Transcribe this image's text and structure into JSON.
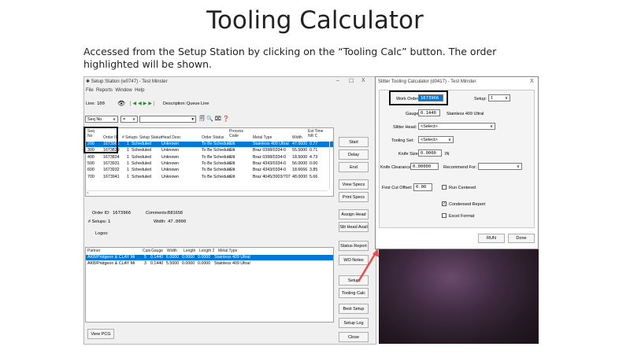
{
  "slide": {
    "title": "Tooling Calculator",
    "description": "Accessed from the Setup Station by clicking on the “Tooling Calc” button. The order highlighted will be shown."
  },
  "setup_window": {
    "title": "Setup Station (w0747) - Test Minster",
    "menu": [
      "File",
      "Reports",
      "Window",
      "Help"
    ],
    "line_label": "Line:",
    "line_value": "100",
    "description_label": "Description:",
    "description_value": "Queue Line",
    "seq_dropdown": "Seq No",
    "op_dropdown": "=",
    "columns": [
      "Seq No",
      "Order ID",
      "# Setups",
      "Setup Status",
      "Head Desc",
      "Order Status",
      "Process Code",
      "Metal Type",
      "Width",
      "Est Time NR C"
    ],
    "rows": [
      [
        "200",
        "1673966",
        "1",
        "Scheduled",
        "Unknown",
        "To Be Schedule",
        "Slit",
        "Stainless 409 Ultral",
        "47.0000",
        "0.77"
      ],
      [
        "300",
        "1673829",
        "1",
        "Scheduled",
        "Unknown",
        "To Be Schedule",
        "Slit",
        "Braz 0398/0334-0",
        "55.5000",
        "0.71"
      ],
      [
        "400",
        "1673824",
        "1",
        "Scheduled",
        "Unknown",
        "To Be Schedule",
        "Slit",
        "Braz 0398/0334-0",
        "18.5000",
        "4.73"
      ],
      [
        "500",
        "1673931",
        "1",
        "Scheduled",
        "Unknown",
        "To Be Schedule",
        "Slit",
        "Braz 4343/0334-0",
        "56.0000",
        "0.00"
      ],
      [
        "600",
        "1673932",
        "1",
        "Scheduled",
        "Unknown",
        "To Be Schedule",
        "Slit",
        "Braz 4343/0334-0",
        "18.6666",
        "3.85"
      ],
      [
        "700",
        "1673941",
        "1",
        "Scheduled",
        "Unknown",
        "To Be Schedule",
        "Slit",
        "Braz 4045/3003/707",
        "48.0000",
        "5.66"
      ]
    ],
    "details": {
      "order_id_label": "Order ID:",
      "order_id": "1673966",
      "comments_label": "Comments:",
      "comments": "B81658",
      "setups_label": "# Setups:",
      "setups": "1",
      "width_label": "Width:",
      "width": "47.0000",
      "logos_label": "Logos:"
    },
    "partner_columns": [
      "Partner",
      "Cuts",
      "Gauge",
      "Width",
      "Length",
      "Length 2",
      "Metal Type"
    ],
    "partner_rows": [
      [
        "AKB/Pridgeon & CLAY Mi",
        "5",
        "0.1440",
        "6.0000",
        "0.0000",
        "0.0000",
        "Stainless 409 Ultral"
      ],
      [
        "AKB/Pridgeon & CLAY Mi",
        "3",
        "0.1440",
        "5.5000",
        "0.0000",
        "0.0000",
        "Stainless 409 Ultral"
      ]
    ],
    "buttons": {
      "start": "Start",
      "delay": "Delay",
      "end": "End",
      "view_specs": "View Specs",
      "print_specs": "Print Specs",
      "assign_head": "Assign Head",
      "slit_head_avail": "Slit Head Avail",
      "status_report": "Status Report",
      "wo_notes": "WO Notes",
      "setup": "Setup",
      "tooling_calc": "Tooling Calc",
      "best_setup": "Best Setup",
      "setup_log": "Setup Log",
      "close": "Close",
      "view_pcg": "View PCG"
    }
  },
  "slitter_window": {
    "title": "Slitter Tooling Calculator (d0417) - Test Minster",
    "work_order_label": "Work Order:",
    "work_order": "1673966",
    "setup_label": "Setup:",
    "setup": "1",
    "gauge_label": "Gauge:",
    "gauge": "0.1440",
    "metal": "Stainless 409 Ultral",
    "slitter_head_label": "Slitter Head:",
    "slitter_head": "<Select>",
    "tooling_set_label": "Tooling Set:",
    "tooling_set": "<Select>",
    "knife_size_label": "Knife Size:",
    "knife_size": "0.0000",
    "knife_unit": "IN",
    "knife_clearance_label": "Knife Clearance:",
    "knife_clearance": "0.00000",
    "recommend_label": "Recommend For:",
    "first_cut_label": "First Cut Offset:",
    "first_cut": "0.00",
    "run_centered": "Run Centered",
    "condensed_report": "Condensed Report",
    "excel_format": "Excel Format",
    "run": "RUN",
    "done": "Done"
  },
  "colors": {
    "selection": "#0078d7",
    "arrow": "#e0504f"
  }
}
